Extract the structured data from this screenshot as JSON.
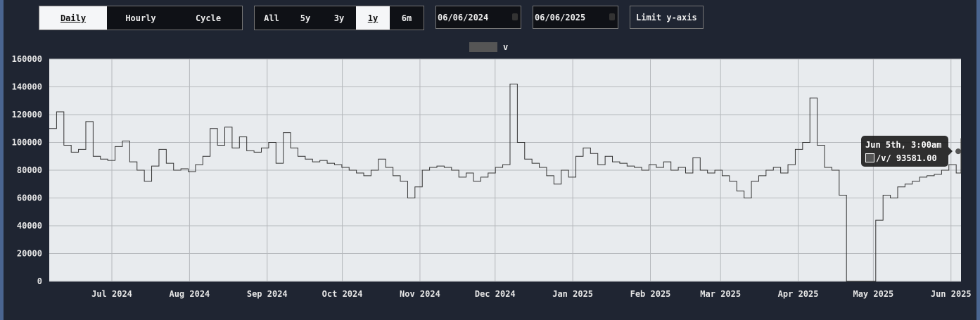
{
  "toolbar": {
    "modes": [
      {
        "label": "Daily",
        "active": true
      },
      {
        "label": "Hourly",
        "active": false
      },
      {
        "label": "Cycle",
        "active": false
      }
    ],
    "ranges": [
      {
        "label": "All",
        "active": false
      },
      {
        "label": "5y",
        "active": false
      },
      {
        "label": "3y",
        "active": false
      },
      {
        "label": "1y",
        "active": true
      },
      {
        "label": "6m",
        "active": false
      }
    ],
    "start_date": "06/06/2024",
    "end_date": "06/06/2025",
    "limit_label": "Limit y-axis"
  },
  "tooltip": {
    "title": "Jun 5th, 3:00am",
    "series": "/v/",
    "value": "93581.00"
  },
  "chart_data": {
    "type": "line",
    "step": true,
    "title": "",
    "xlabel": "",
    "ylabel": "",
    "legend": [
      {
        "name": "v",
        "color": "#555555"
      }
    ],
    "legend_position": "top-center",
    "ylim": [
      0,
      160000
    ],
    "yticks": [
      0,
      20000,
      40000,
      60000,
      80000,
      100000,
      120000,
      140000,
      160000
    ],
    "xticks": [
      {
        "label": "Jul 2024",
        "day": 25
      },
      {
        "label": "Aug 2024",
        "day": 56
      },
      {
        "label": "Sep 2024",
        "day": 87
      },
      {
        "label": "Oct 2024",
        "day": 117
      },
      {
        "label": "Nov 2024",
        "day": 148
      },
      {
        "label": "Dec 2024",
        "day": 178
      },
      {
        "label": "Jan 2025",
        "day": 209
      },
      {
        "label": "Feb 2025",
        "day": 240
      },
      {
        "label": "Mar 2025",
        "day": 268
      },
      {
        "label": "Apr 2025",
        "day": 299
      },
      {
        "label": "May 2025",
        "day": 329
      },
      {
        "label": "Jun 2025",
        "day": 360
      }
    ],
    "start": "2024-06-06",
    "end_day": 364,
    "step_days": 2.92,
    "values": [
      110000,
      122000,
      98000,
      93000,
      95000,
      115000,
      90000,
      88000,
      87000,
      97000,
      101000,
      86000,
      80000,
      72000,
      83000,
      95000,
      85000,
      80000,
      81000,
      79000,
      84000,
      90000,
      110000,
      98000,
      111000,
      96000,
      104000,
      94000,
      93000,
      96000,
      100000,
      85000,
      107000,
      96000,
      90000,
      88000,
      86000,
      87000,
      85000,
      84000,
      82000,
      80000,
      78000,
      76000,
      80000,
      88000,
      82000,
      76000,
      72000,
      60000,
      68000,
      80000,
      82000,
      83000,
      82000,
      80000,
      75000,
      78000,
      72000,
      75000,
      78000,
      82000,
      84000,
      142000,
      100000,
      88000,
      85000,
      82000,
      76000,
      70000,
      80000,
      75000,
      90000,
      96000,
      92000,
      84000,
      90000,
      86000,
      85000,
      83000,
      82000,
      80000,
      84000,
      82000,
      86000,
      80000,
      82000,
      78000,
      89000,
      80000,
      78000,
      80000,
      76000,
      72000,
      65000,
      60000,
      72000,
      76000,
      80000,
      82000,
      78000,
      84000,
      95000,
      100000,
      132000,
      98000,
      82000,
      80000,
      62000,
      0,
      0,
      0,
      0,
      44000,
      62000,
      60000,
      68000,
      70000,
      72000,
      75000,
      76000,
      77000,
      80000,
      84000,
      78000,
      103000,
      93581
    ]
  }
}
